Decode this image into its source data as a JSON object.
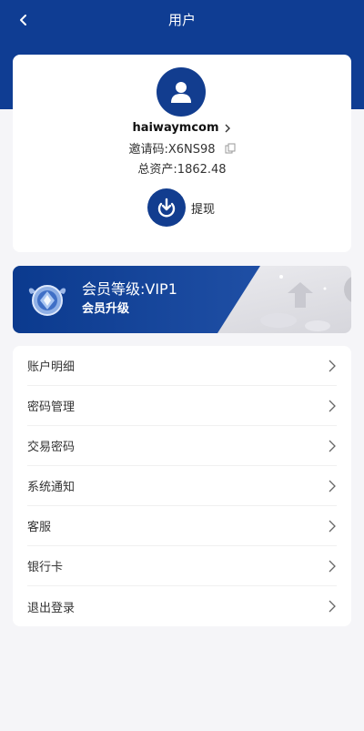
{
  "header": {
    "title": "用户"
  },
  "profile": {
    "username": "haiwaymcom",
    "invite_code": "邀请码:X6NS98",
    "total_assets": "总资产:1862.48",
    "withdraw_label": "提现"
  },
  "vip": {
    "level_text": "会员等级:VIP1",
    "upgrade_label": "会员升级"
  },
  "menu": {
    "items": [
      {
        "label": "账户明细"
      },
      {
        "label": "密码管理"
      },
      {
        "label": "交易密码"
      },
      {
        "label": "系统通知"
      },
      {
        "label": "客服"
      },
      {
        "label": "银行卡"
      },
      {
        "label": "退出登录"
      }
    ]
  },
  "colors": {
    "brand": "#0f3d93",
    "background": "#f5f5f8",
    "card": "#ffffff"
  }
}
